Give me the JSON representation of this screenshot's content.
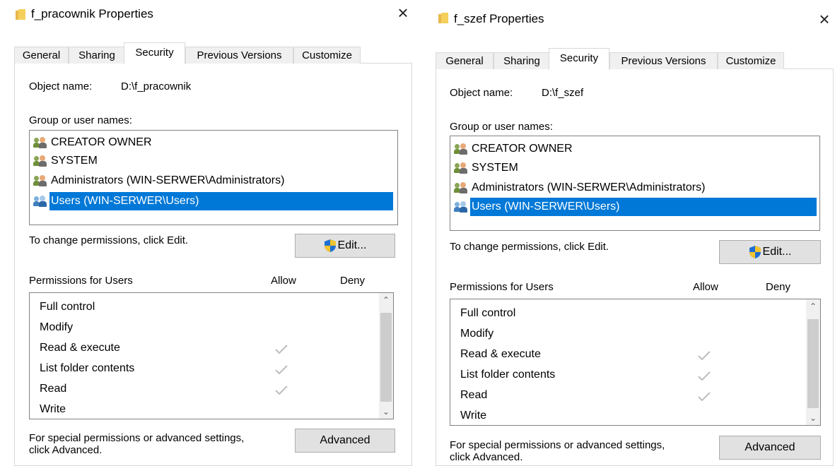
{
  "dialogs": [
    {
      "title": "f_pracownik Properties",
      "tabs": [
        "General",
        "Sharing",
        "Security",
        "Previous Versions",
        "Customize"
      ],
      "active_tab": "Security",
      "object_name_label": "Object name:",
      "object_name_value": "D:\\f_pracownik",
      "group_label": "Group or user names:",
      "users": [
        {
          "name": "CREATOR OWNER",
          "icon": "users-icon",
          "selected": false
        },
        {
          "name": "SYSTEM",
          "icon": "users-icon",
          "selected": false
        },
        {
          "name": "Administrators (WIN-SERWER\\Administrators)",
          "icon": "users-icon",
          "selected": false
        },
        {
          "name": "Users (WIN-SERWER\\Users)",
          "icon": "users-icon",
          "selected": true
        }
      ],
      "change_text": "To change permissions, click Edit.",
      "edit_label": "Edit...",
      "permissions_label": "Permissions for Users",
      "allow_label": "Allow",
      "deny_label": "Deny",
      "permissions": [
        {
          "name": "Full control",
          "allow": false,
          "deny": false
        },
        {
          "name": "Modify",
          "allow": false,
          "deny": false
        },
        {
          "name": "Read & execute",
          "allow": true,
          "deny": false
        },
        {
          "name": "List folder contents",
          "allow": true,
          "deny": false
        },
        {
          "name": "Read",
          "allow": true,
          "deny": false
        },
        {
          "name": "Write",
          "allow": false,
          "deny": false
        }
      ],
      "special_text_line1": "For special permissions or advanced settings,",
      "special_text_line2": "click Advanced.",
      "advanced_label": "Advanced"
    },
    {
      "title": "f_szef Properties",
      "tabs": [
        "General",
        "Sharing",
        "Security",
        "Previous Versions",
        "Customize"
      ],
      "active_tab": "Security",
      "object_name_label": "Object name:",
      "object_name_value": "D:\\f_szef",
      "group_label": "Group or user names:",
      "users": [
        {
          "name": "CREATOR OWNER",
          "icon": "users-icon",
          "selected": false
        },
        {
          "name": "SYSTEM",
          "icon": "users-icon",
          "selected": false
        },
        {
          "name": "Administrators (WIN-SERWER\\Administrators)",
          "icon": "users-icon",
          "selected": false
        },
        {
          "name": "Users (WIN-SERWER\\Users)",
          "icon": "users-icon",
          "selected": true
        }
      ],
      "change_text": "To change permissions, click Edit.",
      "edit_label": "Edit...",
      "permissions_label": "Permissions for Users",
      "allow_label": "Allow",
      "deny_label": "Deny",
      "permissions": [
        {
          "name": "Full control",
          "allow": false,
          "deny": false
        },
        {
          "name": "Modify",
          "allow": false,
          "deny": false
        },
        {
          "name": "Read & execute",
          "allow": true,
          "deny": false
        },
        {
          "name": "List folder contents",
          "allow": true,
          "deny": false
        },
        {
          "name": "Read",
          "allow": true,
          "deny": false
        },
        {
          "name": "Write",
          "allow": false,
          "deny": false
        }
      ],
      "special_text_line1": "For special permissions or advanced settings,",
      "special_text_line2": "click Advanced.",
      "advanced_label": "Advanced"
    }
  ],
  "colors": {
    "selection": "#0078d7",
    "button_face": "#e1e1e1",
    "check_mark": "#bdbdbd",
    "folder_icon": "#f5cf5c"
  }
}
